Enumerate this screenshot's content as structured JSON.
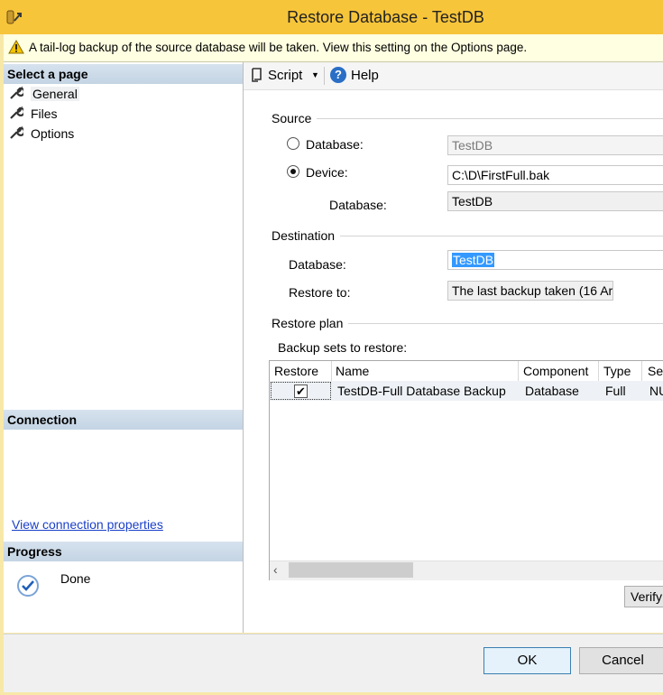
{
  "window": {
    "title": "Restore Database - TestDB"
  },
  "warning": {
    "text": "A tail-log backup of the source database will be taken. View this setting on the Options page."
  },
  "left": {
    "select_page_title": "Select a page",
    "pages": [
      {
        "label": "General",
        "selected": true
      },
      {
        "label": "Files",
        "selected": false
      },
      {
        "label": "Options",
        "selected": false
      }
    ],
    "connection_title": "Connection",
    "connection_link": "View connection properties",
    "progress_title": "Progress",
    "progress_status": "Done"
  },
  "toolbar": {
    "script_label": "Script",
    "help_label": "Help"
  },
  "source": {
    "title": "Source",
    "database_radio_label": "Database:",
    "database_value": "TestDB",
    "device_radio_label": "Device:",
    "device_value": "C:\\D\\FirstFull.bak",
    "device_database_label": "Database:",
    "device_database_value": "TestDB",
    "selected": "device"
  },
  "destination": {
    "title": "Destination",
    "database_label": "Database:",
    "database_value": "TestDB",
    "restore_to_label": "Restore to:",
    "restore_to_value": "The last backup taken (16 Ara"
  },
  "restore_plan": {
    "title": "Restore plan",
    "backup_sets_label": "Backup sets to restore:",
    "columns": [
      "Restore",
      "Name",
      "Component",
      "Type",
      "Se"
    ],
    "rows": [
      {
        "restore": true,
        "name": "TestDB-Full Database Backup",
        "component": "Database",
        "type": "Full",
        "server": "NU"
      }
    ],
    "verify_label": "Verify"
  },
  "footer": {
    "ok_label": "OK",
    "cancel_label": "Cancel"
  }
}
